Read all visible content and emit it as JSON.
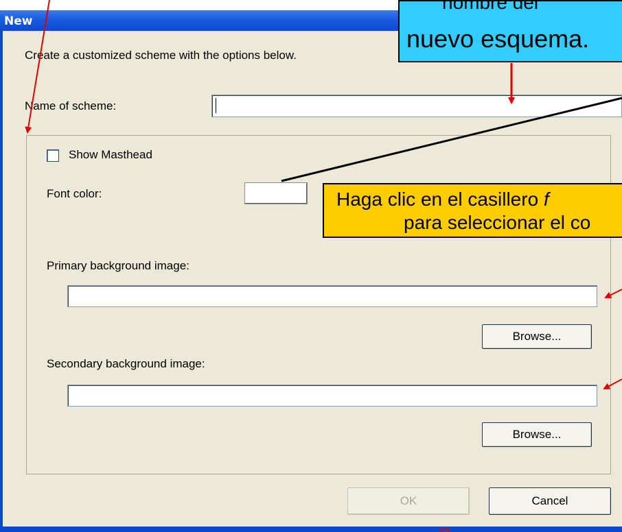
{
  "window": {
    "title": "New"
  },
  "dialog": {
    "description": "Create a customized scheme with the options below.",
    "name_label": "Name of scheme:",
    "name_value": "",
    "show_masthead_label": "Show Masthead",
    "show_masthead_checked": false,
    "font_color_label": "Font color:",
    "primary_label": "Primary background image:",
    "primary_value": "",
    "browse_label": "Browse...",
    "secondary_label": "Secondary background image:",
    "secondary_value": "",
    "ok_label": "OK",
    "ok_enabled": false,
    "cancel_label": "Cancel"
  },
  "annotations": {
    "blue_callout": {
      "line1": "nombre del",
      "line2": "nuevo esquema.",
      "color": "#33ccff"
    },
    "yellow_callout": {
      "line1_a": "Haga clic en el casillero ",
      "line1_b": "f",
      "line2": "para seleccionar el co",
      "color": "#ffcc00"
    }
  },
  "colors": {
    "titlebar": "#0a48cc",
    "dialog_bg": "#ece9d8",
    "arrow_red": "#e00000"
  }
}
